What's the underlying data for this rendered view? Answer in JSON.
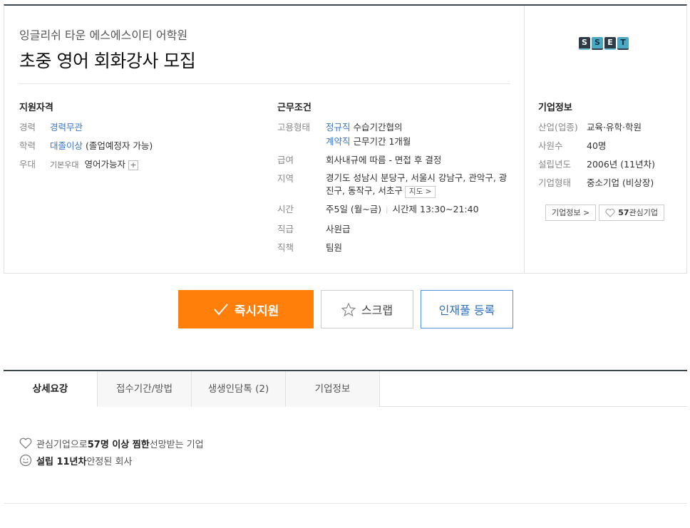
{
  "job": {
    "company": "잉글리쉬 타운 에스에스이티 어학원",
    "title": "초중 영어 회화강사 모집"
  },
  "qualification": {
    "title": "지원자격",
    "career_label": "경력",
    "career_value": "경력무관",
    "edu_label": "학력",
    "edu_value": "대졸이상",
    "edu_note": "(졸업예정자 가능)",
    "pref_label": "우대",
    "pref_mini": "기본우대",
    "pref_value": "영어가능자",
    "pref_plus": "+"
  },
  "conditions": {
    "title": "근무조건",
    "type_label": "고용형태",
    "type1": "정규직",
    "type1_note": "수습기간협의",
    "type2": "계약직",
    "type2_note": "근무기간 1개월",
    "salary_label": "급여",
    "salary_value": "회사내규에 따름 - 면접 후 결정",
    "region_label": "지역",
    "region_value": "경기도 성남시 분당구, 서울시 강남구, 관악구, 광진구, 동작구, 서초구",
    "map_btn": "지도 >",
    "time_label": "시간",
    "time_days": "주5일 (월~금)",
    "time_sep": "|",
    "time_hours": "시간제 13:30~21:40",
    "rank_label": "직급",
    "rank_value": "사원급",
    "duty_label": "직책",
    "duty_value": "팀원"
  },
  "company_info": {
    "title": "기업정보",
    "logo_letters": [
      "S",
      "S",
      "E",
      "T"
    ],
    "industry_label": "산업(업종)",
    "industry_value": "교육·유학·학원",
    "staff_label": "사원수",
    "staff_value": "40명",
    "founded_label": "설립년도",
    "founded_value": "2006년 (11년차)",
    "form_label": "기업형태",
    "form_value": "중소기업 (비상장)",
    "info_btn": "기업정보 >",
    "fav_count": "57",
    "fav_label": "관심기업"
  },
  "actions": {
    "apply": "즉시지원",
    "scrap": "스크랩",
    "pool": "인재풀 등록"
  },
  "tabs": [
    "상세요강",
    "접수기간/방법",
    "생생인담톡 (2)",
    "기업정보"
  ],
  "benefits": {
    "fav_pre": "관심기업으로 ",
    "fav_bold": "57명 이상 찜한",
    "fav_post": " 선망받는 기업",
    "est_bold": "설립 11년차",
    "est_post": " 안정된 회사"
  },
  "colors": {
    "accent": "#ff7f0a",
    "link": "#3a76c7",
    "border_dark": "#3d4650"
  }
}
